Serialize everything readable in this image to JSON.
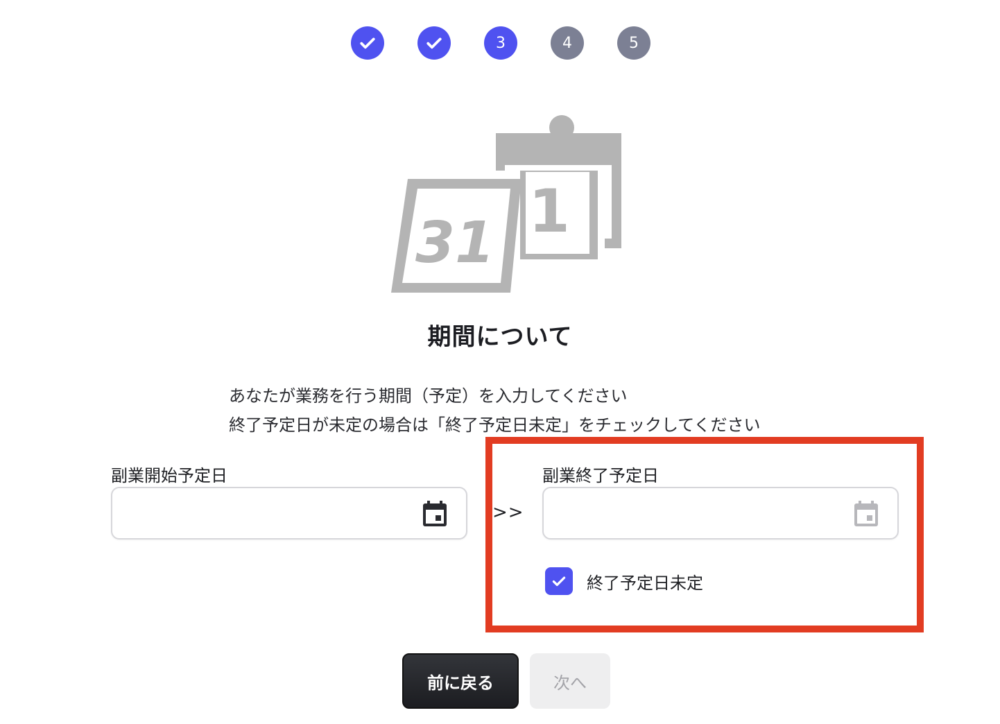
{
  "stepper": {
    "steps": [
      {
        "label": "",
        "state": "done"
      },
      {
        "label": "",
        "state": "done"
      },
      {
        "label": "3",
        "state": "current"
      },
      {
        "label": "4",
        "state": "todo"
      },
      {
        "label": "5",
        "state": "todo"
      }
    ]
  },
  "illustration": {
    "icon": "calendar-illustration-icon",
    "front_page_number": "31",
    "back_page_number": "1"
  },
  "heading": "期間について",
  "description": {
    "line1": "あなたが業務を行う期間（予定）を入力してください",
    "line2": "終了予定日が未定の場合は「終了予定日未定」をチェックしてください"
  },
  "start_field": {
    "label": "副業開始予定日",
    "value": "",
    "icon": "calendar-icon"
  },
  "separator": ">>",
  "end_field": {
    "label": "副業終了予定日",
    "value": "",
    "icon": "calendar-icon",
    "disabled": true
  },
  "undecided_checkbox": {
    "label": "終了予定日未定",
    "checked": true
  },
  "buttons": {
    "back_label": "前に戻る",
    "next_label": "次へ"
  },
  "colors": {
    "accent": "#4f52f0",
    "step_inactive": "#7c8094",
    "highlight": "#e23c22",
    "illustration": "#b4b4b4"
  }
}
